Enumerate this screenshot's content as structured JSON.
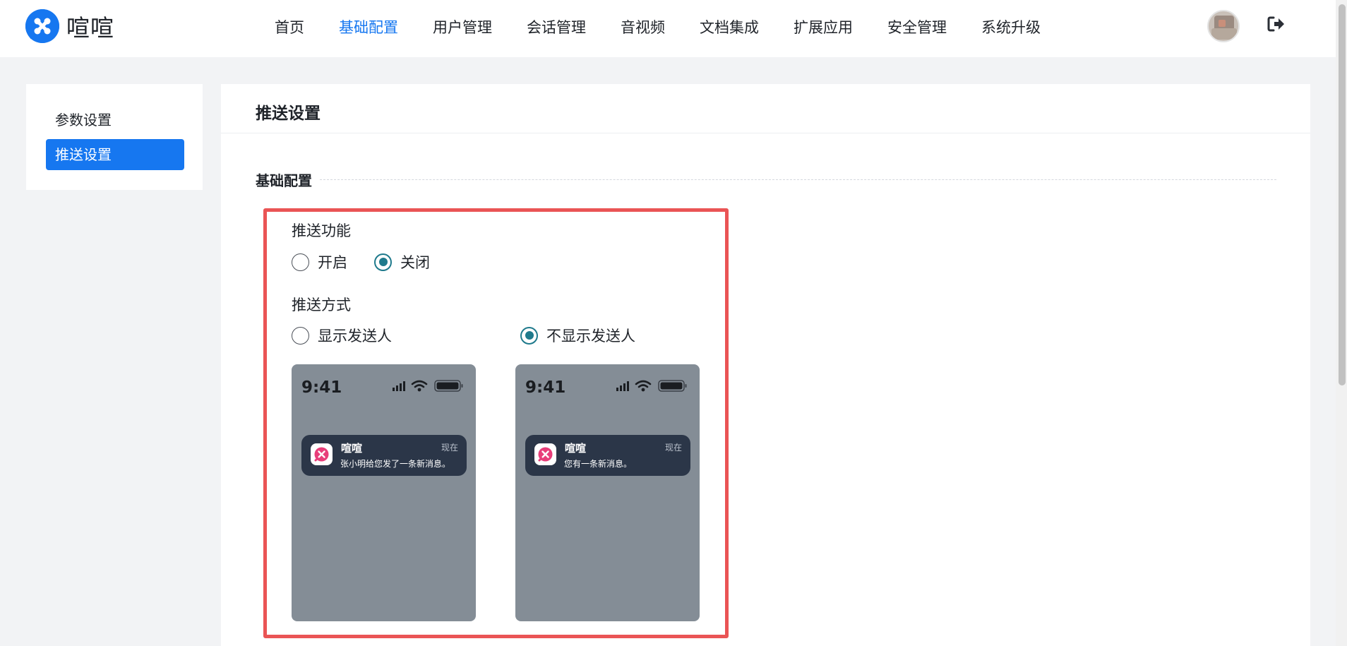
{
  "brand": {
    "name": "喧喧",
    "accent": "#1677f0"
  },
  "nav": {
    "items": [
      {
        "label": "首页",
        "active": false
      },
      {
        "label": "基础配置",
        "active": true
      },
      {
        "label": "用户管理",
        "active": false
      },
      {
        "label": "会话管理",
        "active": false
      },
      {
        "label": "音视频",
        "active": false
      },
      {
        "label": "文档集成",
        "active": false
      },
      {
        "label": "扩展应用",
        "active": false
      },
      {
        "label": "安全管理",
        "active": false
      },
      {
        "label": "系统升级",
        "active": false
      }
    ],
    "logout_icon": "sign-out-icon"
  },
  "sidebar": {
    "items": [
      {
        "label": "参数设置",
        "active": false
      },
      {
        "label": "推送设置",
        "active": true
      }
    ]
  },
  "main": {
    "title": "推送设置",
    "section_title": "基础配置",
    "push_function": {
      "label": "推送功能",
      "options": [
        {
          "label": "开启",
          "checked": false
        },
        {
          "label": "关闭",
          "checked": true
        }
      ]
    },
    "push_mode": {
      "label": "推送方式",
      "options": [
        {
          "label": "显示发送人",
          "checked": false
        },
        {
          "label": "不显示发送人",
          "checked": true
        }
      ]
    },
    "previews": [
      {
        "time": "9:41",
        "app_name": "喧喧",
        "notif_time": "现在",
        "message": "张小明给您发了一条新消息。"
      },
      {
        "time": "9:41",
        "app_name": "喧喧",
        "notif_time": "现在",
        "message": "您有一条新消息。"
      }
    ],
    "highlight_color": "#ea5455",
    "radio_color": "#1f7a8c"
  }
}
